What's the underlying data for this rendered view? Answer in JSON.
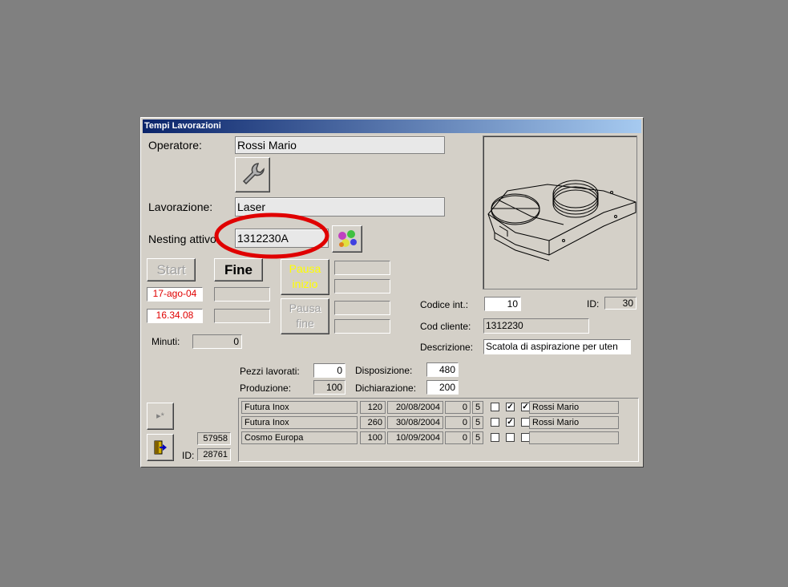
{
  "window": {
    "title": "Tempi Lavorazioni"
  },
  "operatore": {
    "label": "Operatore:",
    "value": "Rossi Mario"
  },
  "lavorazione": {
    "label": "Lavorazione:",
    "value": "Laser"
  },
  "nesting": {
    "label": "Nesting attivo:",
    "value": "1312230A"
  },
  "buttons": {
    "start": "Start",
    "fine": "Fine",
    "pausa_inizio": "Pausa inizio",
    "pausa_fine": "Pausa fine"
  },
  "times": {
    "date": "17-ago-04",
    "time": "16.34.08"
  },
  "minuti": {
    "label": "Minuti:",
    "value": "0"
  },
  "codice_int": {
    "label": "Codice  int.:",
    "value": "10"
  },
  "id_top": {
    "label": "ID:",
    "value": "30"
  },
  "cod_cliente": {
    "label": "Cod cliente:",
    "value": "1312230"
  },
  "descrizione": {
    "label": "Descrizione:",
    "value": "Scatola di aspirazione per uten"
  },
  "counts": {
    "pezzi_label": "Pezzi lavorati:",
    "pezzi": "0",
    "produzione_label": "Produzione:",
    "produzione": "100",
    "disposizione_label": "Disposizione:",
    "disposizione": "480",
    "dichiarazione_label": "Dichiarazione:",
    "dichiarazione": "200"
  },
  "bottom": {
    "num": "57958",
    "id_label": "ID:",
    "id_value": "28761"
  },
  "rows": [
    {
      "cliente": "Futura Inox",
      "qta": "120",
      "data": "20/08/2004",
      "a": "0",
      "b": "5",
      "c1": false,
      "c2": true,
      "c3": true,
      "operatore": "Rossi Mario"
    },
    {
      "cliente": "Futura Inox",
      "qta": "260",
      "data": "30/08/2004",
      "a": "0",
      "b": "5",
      "c1": false,
      "c2": true,
      "c3": false,
      "operatore": "Rossi Mario"
    },
    {
      "cliente": "Cosmo Europa",
      "qta": "100",
      "data": "10/09/2004",
      "a": "0",
      "b": "5",
      "c1": false,
      "c2": false,
      "c3": false,
      "operatore": ""
    }
  ],
  "icons": {
    "tool": "wrench-icon",
    "nesting": "parts-icon",
    "new_record": "new-record-icon",
    "exit": "exit-door-icon"
  },
  "colors": {
    "highlight_circle": "#e00000",
    "pausa_text": "#ffff00",
    "time_text": "#e00000"
  }
}
